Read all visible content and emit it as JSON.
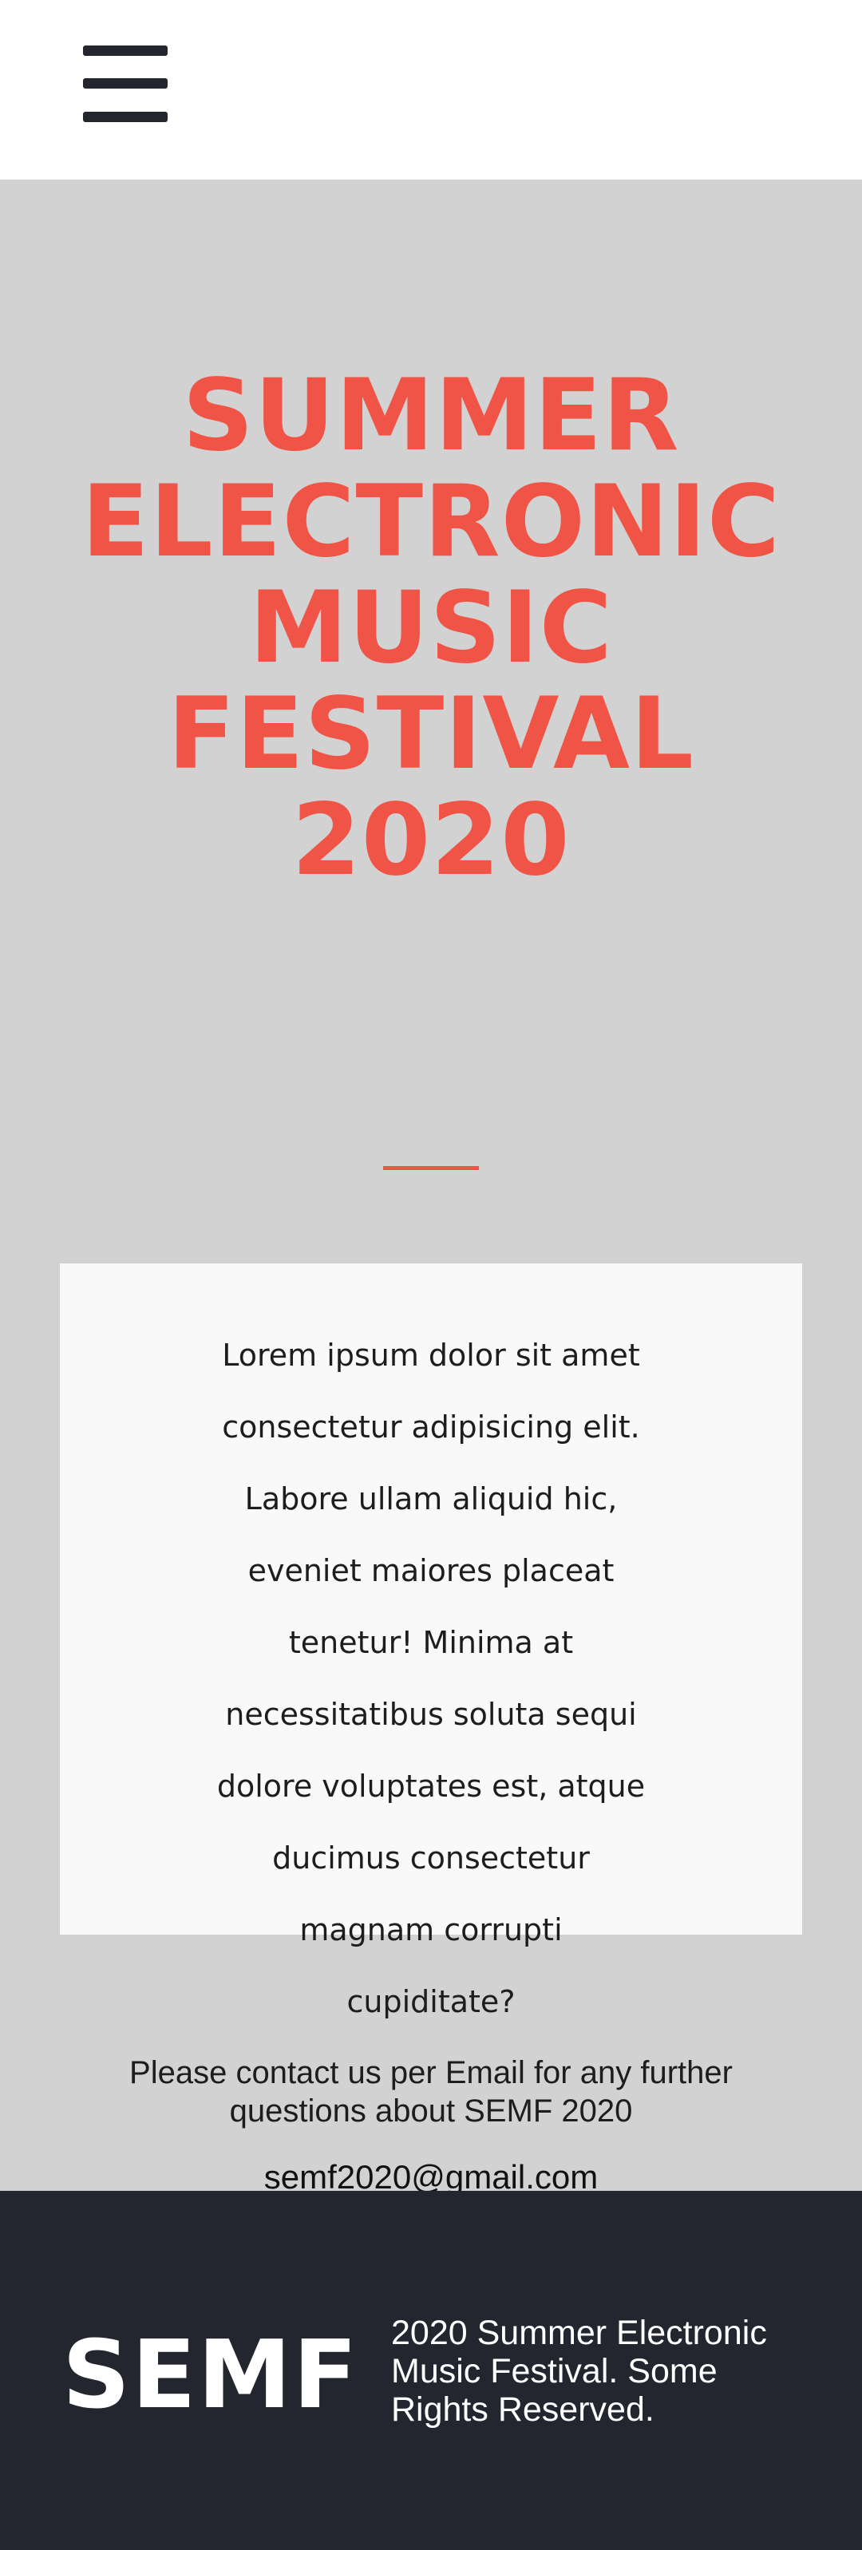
{
  "header": {
    "menu_icon": "hamburger-menu-icon"
  },
  "hero": {
    "title_lines": [
      "SUMMER",
      "ELECTRONIC",
      "MUSIC",
      "FESTIVAL",
      "2020"
    ]
  },
  "about": {
    "text": "Lorem ipsum dolor sit amet consectetur adipisicing elit. Labore ullam aliquid hic, eveniet maiores placeat tenetur! Minima at necessitatibus soluta sequi dolore voluptates est, atque ducimus consectetur magnam corrupti cupiditate?"
  },
  "contact": {
    "text": "Please contact us per Email for any further questions about SEMF 2020",
    "email": "semf2020@gmail.com"
  },
  "footer": {
    "logo": "SEMF",
    "text": "2020 Summer Electronic Music Festival. Some Rights Reserved."
  },
  "colors": {
    "accent": "#ef5447",
    "background": "#d2d2d2",
    "card": "#f9f9f9",
    "footer": "#24262f",
    "header": "#ffffff"
  }
}
